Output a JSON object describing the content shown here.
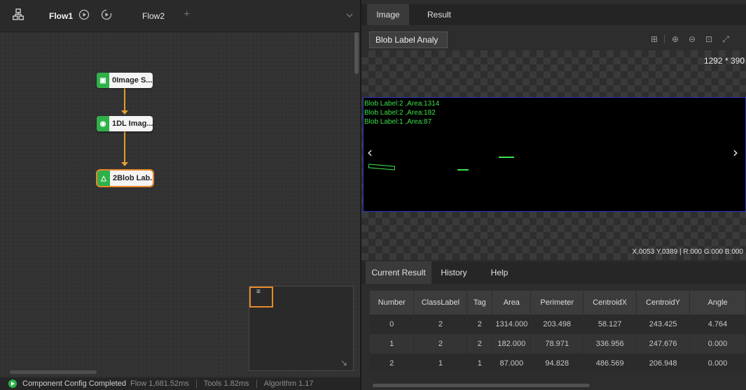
{
  "left_toolbar": {
    "flow_tabs": [
      {
        "label": "Flow1",
        "active": true
      },
      {
        "label": "Flow2",
        "active": false
      }
    ]
  },
  "flow_nodes": [
    {
      "label": "0Image S...",
      "icon": "image-source-icon"
    },
    {
      "label": "1DL Imag...",
      "icon": "deep-learning-icon"
    },
    {
      "label": "2Blob Lab...",
      "icon": "blob-label-icon",
      "selected": true
    }
  ],
  "status_bar": {
    "message": "Component Config Completed",
    "flow_time": "Flow 1,681.52ms",
    "tools_time": "Tools 1.82ms",
    "algorithm_time": "Algorithm 1.17"
  },
  "right_panel": {
    "top_tabs": [
      {
        "label": "Image",
        "active": true
      },
      {
        "label": "Result",
        "active": false
      }
    ],
    "dropdown_value": "Blob Label Analy",
    "image_size": "1292 * 390",
    "overlay_lines": [
      "Blob Label:2 ,Area:1314",
      "Blob Label:2 ,Area:182",
      "Blob Label:1 ,Area:87"
    ],
    "pixel_info": "X,0053  Y,0389  |  R:000  G:000  B:000",
    "bottom_tabs": [
      {
        "label": "Current Result",
        "active": true
      },
      {
        "label": "History",
        "active": false
      },
      {
        "label": "Help",
        "active": false
      }
    ]
  },
  "results_table": {
    "columns": [
      "Number",
      "ClassLabel",
      "Tag",
      "Area",
      "Perimeter",
      "CentroidX",
      "CentroidY",
      "Angle"
    ],
    "rows": [
      [
        "0",
        "2",
        "2",
        "1314.000",
        "203.498",
        "58.127",
        "243.425",
        "4.764"
      ],
      [
        "1",
        "2",
        "2",
        "182.000",
        "78.971",
        "336.956",
        "247.676",
        "0.000"
      ],
      [
        "2",
        "1",
        "1",
        "87.000",
        "94.828",
        "486.569",
        "206.948",
        "0.000"
      ]
    ]
  },
  "colors": {
    "accent_orange": "#e8872a",
    "node_green": "#2fb14a",
    "overlay_green": "#3ee04a",
    "image_border_blue": "#2c33c8"
  }
}
